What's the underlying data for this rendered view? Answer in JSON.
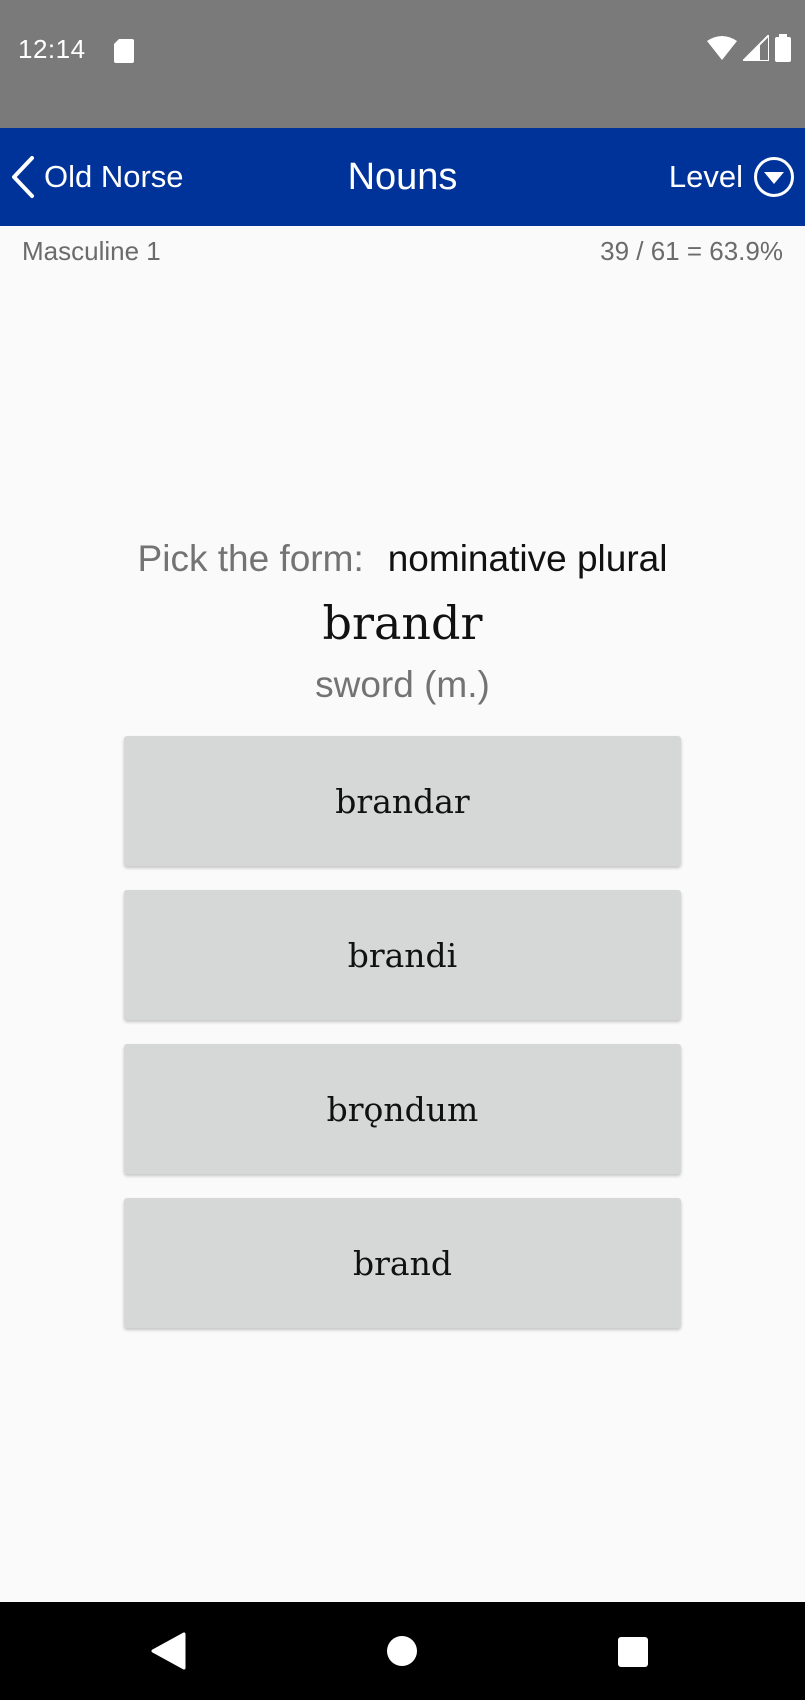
{
  "status_bar": {
    "time": "12:14",
    "icons": [
      "sd-card-icon",
      "wifi-icon",
      "signal-icon",
      "battery-icon"
    ]
  },
  "app_bar": {
    "back_label": "Old Norse",
    "title": "Nouns",
    "level_label": "Level"
  },
  "sub_header": {
    "category": "Masculine 1",
    "score": "39 / 61 = 63.9%"
  },
  "question": {
    "prompt_label": "Pick the form:",
    "form": "nominative plural",
    "headword": "brandr",
    "gloss": "sword (m.)"
  },
  "answers": [
    {
      "label": "brandar"
    },
    {
      "label": "brandi"
    },
    {
      "label": "brǫndum"
    },
    {
      "label": "brand"
    }
  ],
  "colors": {
    "app_bar": "#003399",
    "status_bar": "#7a7a7a",
    "answer_button": "#d6d7d7",
    "background": "#fafafa",
    "nav_bar": "#000000"
  }
}
